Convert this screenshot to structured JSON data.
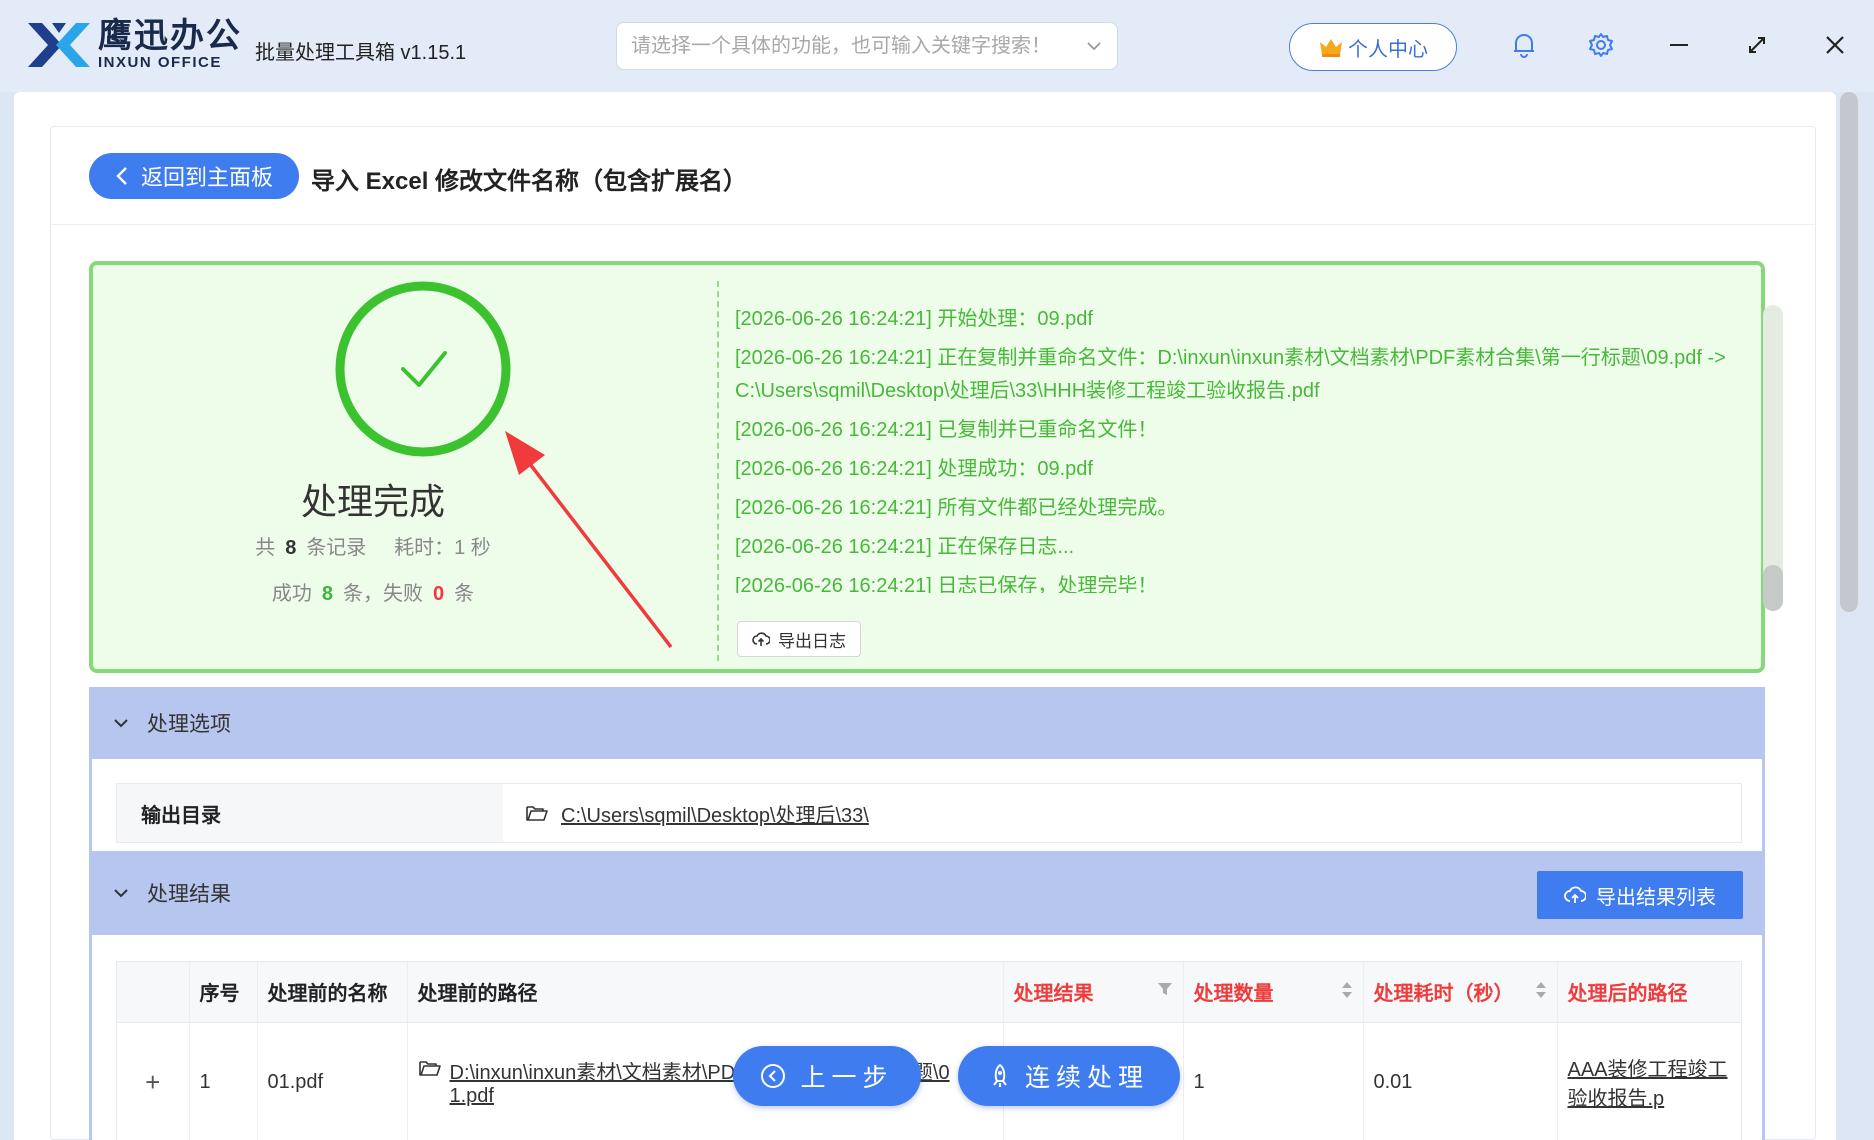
{
  "app": {
    "logo_cn": "鹰迅办公",
    "logo_en": "INXUN OFFICE",
    "title": "批量处理工具箱 v1.15.1",
    "search_placeholder": "请选择一个具体的功能，也可输入关键字搜索！",
    "user_center": "个人中心"
  },
  "page": {
    "back_label": "返回到主面板",
    "title": "导入 Excel 修改文件名称（包含扩展名）"
  },
  "status": {
    "title": "处理完成",
    "total_prefix": "共",
    "total": "8",
    "total_suffix": "条记录",
    "time_label": "耗时：1 秒",
    "success_prefix": "成功",
    "success": "8",
    "fail_prefix": "条，失败",
    "fail": "0",
    "fail_suffix": "条",
    "export_log": "导出日志"
  },
  "log": [
    "[2026-06-26 16:24:21] 开始处理：09.pdf",
    "[2026-06-26 16:24:21] 正在复制并重命名文件：D:\\inxun\\inxun素材\\文档素材\\PDF素材合集\\第一行标题\\09.pdf -> C:\\Users\\sqmil\\Desktop\\处理后\\33\\HHH装修工程竣工验收报告.pdf",
    "[2026-06-26 16:24:21] 已复制并已重命名文件！",
    "[2026-06-26 16:24:21] 处理成功：09.pdf",
    "[2026-06-26 16:24:21] 所有文件都已经处理完成。",
    "[2026-06-26 16:24:21] 正在保存日志...",
    "[2026-06-26 16:24:21] 日志已保存，处理完毕！"
  ],
  "options": {
    "header": "处理选项",
    "output_label": "输出目录",
    "output_path": "C:\\Users\\sqmil\\Desktop\\处理后\\33\\"
  },
  "results": {
    "header": "处理结果",
    "export_label": "导出结果列表",
    "columns": [
      "序号",
      "处理前的名称",
      "处理前的路径",
      "处理结果",
      "处理数量",
      "处理耗时（秒）",
      "处理后的路径"
    ],
    "rows": [
      {
        "expand": "+",
        "index": "1",
        "name": "01.pdf",
        "path_line1": "D:\\inxun\\inxun素材\\文档素材\\PDF素材合集\\第一行标题\\0",
        "path_line2": "1.pdf",
        "count": "1",
        "time": "0.01",
        "after_path": "AAA装修工程竣工验收报告.p"
      }
    ]
  },
  "nav": {
    "prev": "上一步",
    "continue": "连续处理"
  },
  "colors": {
    "accent": "#3e7cf0",
    "success": "#48b83a",
    "fail": "#f03a3a",
    "section": "#b7c6ee"
  }
}
